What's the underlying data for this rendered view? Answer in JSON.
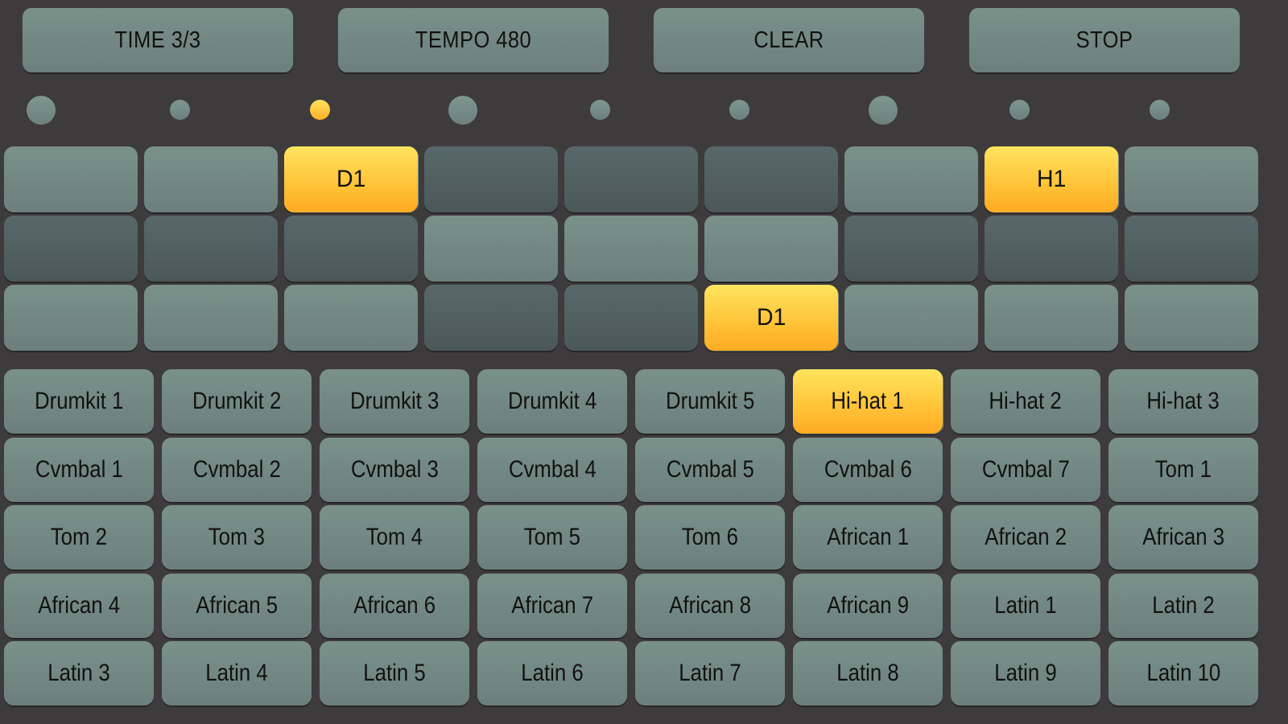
{
  "toolbar": {
    "time_label": "TIME 3/3",
    "tempo_label": "TEMPO 480",
    "clear_label": "CLEAR",
    "stop_label": "STOP"
  },
  "beat_indicator": {
    "count": 9,
    "accent_beats": [
      1,
      4,
      7
    ],
    "current_beat": 3
  },
  "colors": {
    "background": "#3e3b3d",
    "pad_light": "#768b85",
    "pad_dim": "#51605f",
    "active": "#ffc53a"
  },
  "step_grid": {
    "rows": [
      [
        {
          "label": "",
          "state": "light"
        },
        {
          "label": "",
          "state": "light"
        },
        {
          "label": "D1",
          "state": "active"
        },
        {
          "label": "",
          "state": "dim"
        },
        {
          "label": "",
          "state": "dim"
        },
        {
          "label": "",
          "state": "dim"
        },
        {
          "label": "",
          "state": "light"
        },
        {
          "label": "H1",
          "state": "active"
        },
        {
          "label": "",
          "state": "light"
        }
      ],
      [
        {
          "label": "",
          "state": "dim"
        },
        {
          "label": "",
          "state": "dim"
        },
        {
          "label": "",
          "state": "dim"
        },
        {
          "label": "",
          "state": "light"
        },
        {
          "label": "",
          "state": "light"
        },
        {
          "label": "",
          "state": "light"
        },
        {
          "label": "",
          "state": "dim"
        },
        {
          "label": "",
          "state": "dim"
        },
        {
          "label": "",
          "state": "dim"
        }
      ],
      [
        {
          "label": "",
          "state": "light"
        },
        {
          "label": "",
          "state": "light"
        },
        {
          "label": "",
          "state": "light"
        },
        {
          "label": "",
          "state": "dim"
        },
        {
          "label": "",
          "state": "dim"
        },
        {
          "label": "D1",
          "state": "active"
        },
        {
          "label": "",
          "state": "light"
        },
        {
          "label": "",
          "state": "light"
        },
        {
          "label": "",
          "state": "light"
        }
      ]
    ]
  },
  "instruments": {
    "selected": "Hi-hat 1",
    "items": [
      "Drumkit 1",
      "Drumkit 2",
      "Drumkit 3",
      "Drumkit 4",
      "Drumkit 5",
      "Hi-hat 1",
      "Hi-hat 2",
      "Hi-hat 3",
      "Cvmbal 1",
      "Cvmbal 2",
      "Cvmbal 3",
      "Cvmbal 4",
      "Cvmbal 5",
      "Cvmbal 6",
      "Cvmbal 7",
      "Tom 1",
      "Tom 2",
      "Tom 3",
      "Tom 4",
      "Tom 5",
      "Tom 6",
      "African 1",
      "African 2",
      "African 3",
      "African 4",
      "African 5",
      "African 6",
      "African 7",
      "African 8",
      "African 9",
      "Latin 1",
      "Latin 2",
      "Latin 3",
      "Latin 4",
      "Latin 5",
      "Latin 6",
      "Latin 7",
      "Latin 8",
      "Latin 9",
      "Latin 10"
    ]
  }
}
